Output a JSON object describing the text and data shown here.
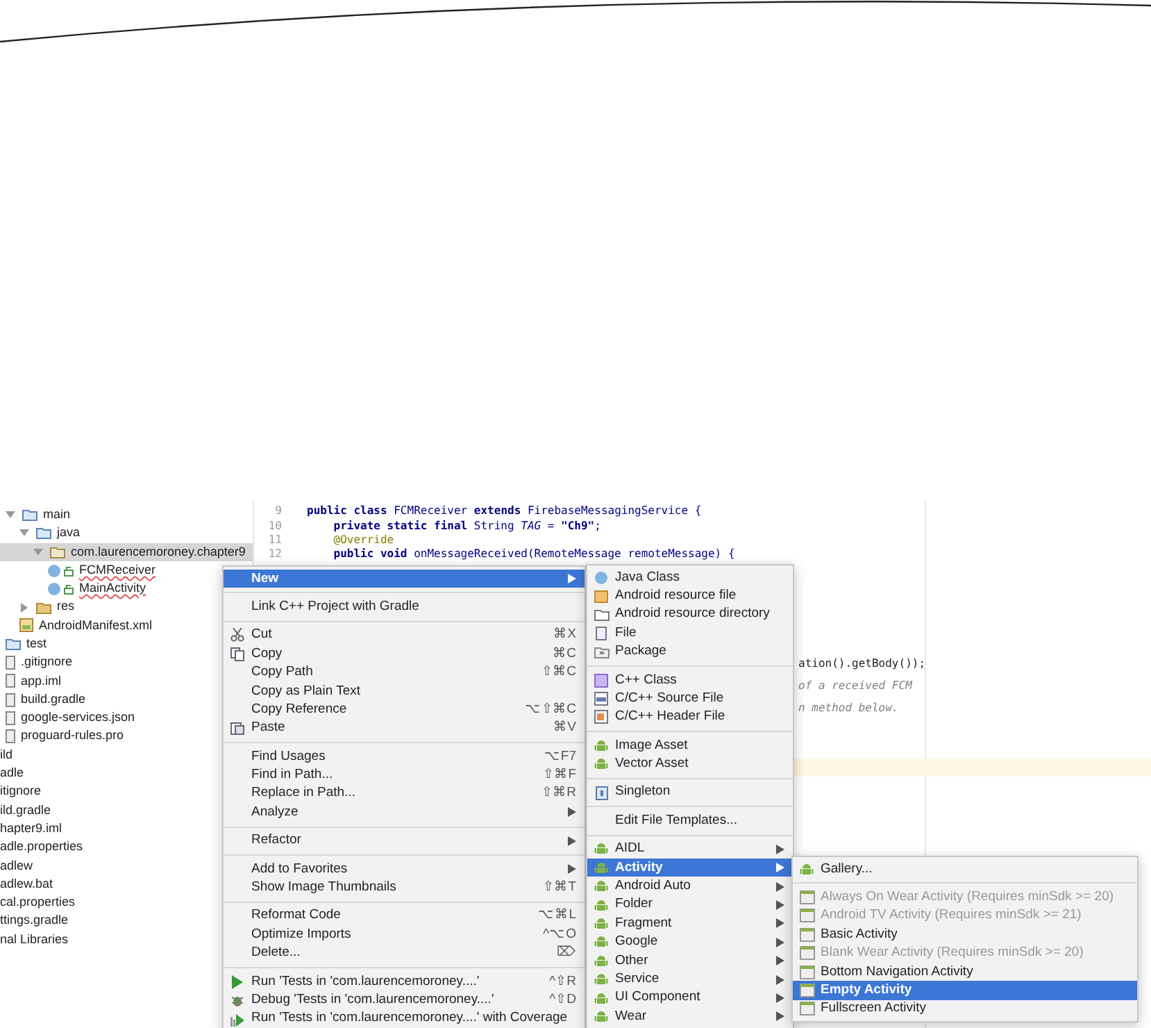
{
  "project_tree": [
    {
      "label": "main",
      "kind": "folder",
      "expanded": true,
      "selected": false,
      "children": [
        {
          "label": "java",
          "kind": "folder",
          "expanded": true,
          "selected": false,
          "children": [
            {
              "label": "com.laurencemoroney.chapter9",
              "kind": "package",
              "expanded": true,
              "selected": true,
              "children": [
                {
                  "label": "FCMReceiver",
                  "kind": "class",
                  "selected": false
                },
                {
                  "label": "MainActivity",
                  "kind": "class",
                  "selected": false
                }
              ]
            }
          ]
        },
        {
          "label": "res",
          "kind": "resfolder",
          "expanded": false,
          "selected": false
        },
        {
          "label": "AndroidManifest.xml",
          "kind": "manifest",
          "selected": false
        }
      ]
    },
    {
      "label": "test",
      "kind": "folder",
      "selected": false
    },
    {
      "label": ".gitignore",
      "kind": "file",
      "selected": false
    },
    {
      "label": "app.iml",
      "kind": "file",
      "selected": false
    },
    {
      "label": "build.gradle",
      "kind": "gradle",
      "selected": false
    },
    {
      "label": "google-services.json",
      "kind": "file",
      "selected": false
    },
    {
      "label": "proguard-rules.pro",
      "kind": "file",
      "selected": false
    },
    {
      "label": "ild",
      "kind": "cut",
      "selected": false
    },
    {
      "label": "adle",
      "kind": "cut",
      "selected": false
    },
    {
      "label": "itignore",
      "kind": "cut",
      "selected": false
    },
    {
      "label": "ild.gradle",
      "kind": "cut",
      "selected": false
    },
    {
      "label": "hapter9.iml",
      "kind": "cut",
      "selected": false
    },
    {
      "label": "adle.properties",
      "kind": "cut",
      "selected": false
    },
    {
      "label": "adlew",
      "kind": "cut",
      "selected": false
    },
    {
      "label": "adlew.bat",
      "kind": "cut",
      "selected": false
    },
    {
      "label": "cal.properties",
      "kind": "cut",
      "selected": false
    },
    {
      "label": "ttings.gradle",
      "kind": "cut",
      "selected": false
    },
    {
      "label": "nal Libraries",
      "kind": "cut",
      "selected": false
    }
  ],
  "editor": {
    "lines": [
      {
        "number": "9",
        "kind": "code",
        "text": "**public class** FCMReceiver **extends** FirebaseMessagingService {"
      },
      {
        "number": "10",
        "kind": "code",
        "text": "    **private static final** String *TAG* = **\"Ch9\"**;"
      },
      {
        "number": "11",
        "kind": "annotation",
        "text": "    @Override"
      },
      {
        "number": "12",
        "kind": "code",
        "text": "    **public void** onMessageReceived(RemoteMessage remoteMessage) {"
      }
    ],
    "fragments": [
      {
        "kind": "code",
        "text": "ation().getBody());"
      },
      {
        "kind": "comment",
        "text": "of a received FCM"
      },
      {
        "kind": "comment",
        "text": "n method below."
      }
    ]
  },
  "context_menu": {
    "groups": [
      [
        {
          "label": "New",
          "submenu": true,
          "kind": "plain",
          "selected": true
        }
      ],
      [
        {
          "label": "Link C++ Project with Gradle",
          "submenu": false,
          "kind": "plain",
          "selected": false
        }
      ],
      [
        {
          "label": "Cut",
          "shortcut": "⌘X",
          "submenu": false,
          "kind": "cut",
          "selected": false
        },
        {
          "label": "Copy",
          "shortcut": "⌘C",
          "submenu": false,
          "kind": "copy",
          "selected": false
        },
        {
          "label": "Copy Path",
          "shortcut": "⇧⌘C",
          "submenu": false,
          "kind": "plain",
          "selected": false
        },
        {
          "label": "Copy as Plain Text",
          "submenu": false,
          "kind": "plain",
          "selected": false
        },
        {
          "label": "Copy Reference",
          "shortcut": "⌥⇧⌘C",
          "submenu": false,
          "kind": "plain",
          "selected": false
        },
        {
          "label": "Paste",
          "shortcut": "⌘V",
          "submenu": false,
          "kind": "paste",
          "selected": false
        }
      ],
      [
        {
          "label": "Find Usages",
          "shortcut": "⌥F7",
          "submenu": false,
          "kind": "plain",
          "selected": false
        },
        {
          "label": "Find in Path...",
          "shortcut": "⇧⌘F",
          "submenu": false,
          "kind": "plain",
          "selected": false
        },
        {
          "label": "Replace in Path...",
          "shortcut": "⇧⌘R",
          "submenu": false,
          "kind": "plain",
          "selected": false
        },
        {
          "label": "Analyze",
          "submenu": true,
          "kind": "plain",
          "selected": false
        }
      ],
      [
        {
          "label": "Refactor",
          "submenu": true,
          "kind": "plain",
          "selected": false
        }
      ],
      [
        {
          "label": "Add to Favorites",
          "submenu": true,
          "kind": "plain",
          "selected": false
        },
        {
          "label": "Show Image Thumbnails",
          "shortcut": "⇧⌘T",
          "submenu": false,
          "kind": "plain",
          "selected": false
        }
      ],
      [
        {
          "label": "Reformat Code",
          "shortcut": "⌥⌘L",
          "submenu": false,
          "kind": "plain",
          "selected": false
        },
        {
          "label": "Optimize Imports",
          "shortcut": "^⌥O",
          "submenu": false,
          "kind": "plain",
          "selected": false
        },
        {
          "label": "Delete...",
          "shortcut": "⌦",
          "submenu": false,
          "kind": "plain",
          "selected": false
        }
      ],
      [
        {
          "label": "Run 'Tests in 'com.laurencemoroney....'",
          "shortcut": "^⇧R",
          "submenu": false,
          "kind": "run",
          "selected": false
        },
        {
          "label": "Debug 'Tests in 'com.laurencemoroney....'",
          "shortcut": "^⇧D",
          "submenu": false,
          "kind": "debug",
          "selected": false
        },
        {
          "label": "Run 'Tests in 'com.laurencemoroney....' with Coverage",
          "submenu": false,
          "kind": "coverage",
          "selected": false
        }
      ]
    ]
  },
  "new_submenu": {
    "groups": [
      [
        {
          "label": "Java Class",
          "kind": "class",
          "submenu": false,
          "selected": false
        },
        {
          "label": "Android resource file",
          "kind": "resource",
          "submenu": false,
          "selected": false
        },
        {
          "label": "Android resource directory",
          "kind": "folder",
          "submenu": false,
          "selected": false
        },
        {
          "label": "File",
          "kind": "file",
          "submenu": false,
          "selected": false
        },
        {
          "label": "Package",
          "kind": "package",
          "submenu": false,
          "selected": false
        }
      ],
      [
        {
          "label": "C++ Class",
          "kind": "cppclass",
          "submenu": false,
          "selected": false
        },
        {
          "label": "C/C++ Source File",
          "kind": "source",
          "submenu": false,
          "selected": false
        },
        {
          "label": "C/C++ Header File",
          "kind": "header",
          "submenu": false,
          "selected": false
        }
      ],
      [
        {
          "label": "Image Asset",
          "kind": "android",
          "submenu": false,
          "selected": false
        },
        {
          "label": "Vector Asset",
          "kind": "android",
          "submenu": false,
          "selected": false
        }
      ],
      [
        {
          "label": "Singleton",
          "kind": "singleton",
          "submenu": false,
          "selected": false
        }
      ],
      [
        {
          "label": "Edit File Templates...",
          "kind": "plain",
          "submenu": false,
          "selected": false
        }
      ],
      [
        {
          "label": "AIDL",
          "kind": "android",
          "submenu": true,
          "selected": false
        },
        {
          "label": "Activity",
          "kind": "android",
          "submenu": true,
          "selected": true
        },
        {
          "label": "Android Auto",
          "kind": "android",
          "submenu": true,
          "selected": false
        },
        {
          "label": "Folder",
          "kind": "android",
          "submenu": true,
          "selected": false
        },
        {
          "label": "Fragment",
          "kind": "android",
          "submenu": true,
          "selected": false
        },
        {
          "label": "Google",
          "kind": "android",
          "submenu": true,
          "selected": false
        },
        {
          "label": "Other",
          "kind": "android",
          "submenu": true,
          "selected": false
        },
        {
          "label": "Service",
          "kind": "android",
          "submenu": true,
          "selected": false
        },
        {
          "label": "UI Component",
          "kind": "android",
          "submenu": true,
          "selected": false
        },
        {
          "label": "Wear",
          "kind": "android",
          "submenu": true,
          "selected": false
        }
      ]
    ]
  },
  "activity_submenu": {
    "groups": [
      [
        {
          "label": "Gallery...",
          "kind": "android",
          "disabled": false,
          "selected": false
        }
      ],
      [
        {
          "label": "Always On Wear Activity (Requires minSdk >= 20)",
          "kind": "template",
          "disabled": true,
          "selected": false
        },
        {
          "label": "Android TV Activity (Requires minSdk >= 21)",
          "kind": "template",
          "disabled": true,
          "selected": false
        },
        {
          "label": "Basic Activity",
          "kind": "template",
          "disabled": false,
          "selected": false
        },
        {
          "label": "Blank Wear Activity (Requires minSdk >= 20)",
          "kind": "template",
          "disabled": true,
          "selected": false
        },
        {
          "label": "Bottom Navigation Activity",
          "kind": "template",
          "disabled": false,
          "selected": false
        },
        {
          "label": "Empty Activity",
          "kind": "template",
          "disabled": false,
          "selected": true
        },
        {
          "label": "Fullscreen Activity",
          "kind": "template",
          "disabled": false,
          "selected": false
        }
      ]
    ]
  }
}
